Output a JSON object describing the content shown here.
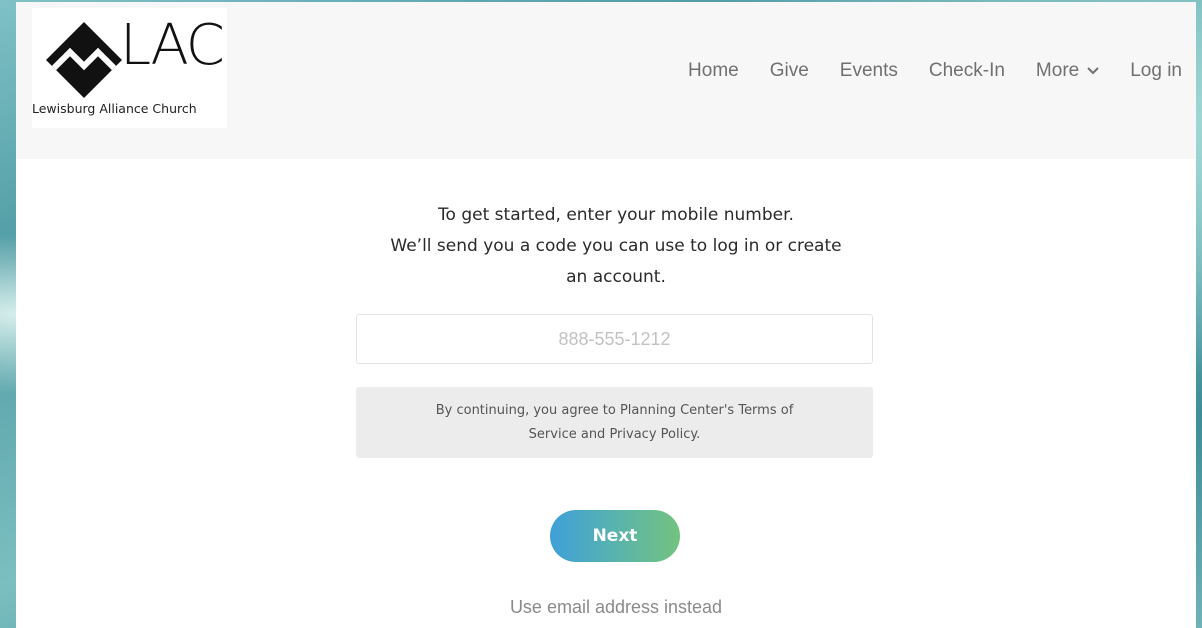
{
  "brand": {
    "logo_letters": "LAC",
    "church_name": "Lewisburg Alliance Church"
  },
  "nav": {
    "items": [
      "Home",
      "Give",
      "Events",
      "Check-In"
    ],
    "more_label": "More",
    "login_label": "Log in"
  },
  "intro": {
    "line1": "To get started, enter your mobile number.",
    "line2": "We’ll send you a code you can use to log in or create",
    "line3": "an account."
  },
  "phone": {
    "value": "",
    "placeholder": "888-555-1212"
  },
  "terms": {
    "line1": "By continuing, you agree to Planning Center's Terms of",
    "line2": "Service and Privacy Policy."
  },
  "actions": {
    "next_label": "Next",
    "email_link": "Use email address instead"
  },
  "colors": {
    "next_gradient_start": "#3fa0d9",
    "next_gradient_end": "#73c27f",
    "nav_text": "#707070"
  },
  "icons": {
    "logo_mark": "mountain-diamond-icon",
    "more": "chevron-down-icon"
  }
}
